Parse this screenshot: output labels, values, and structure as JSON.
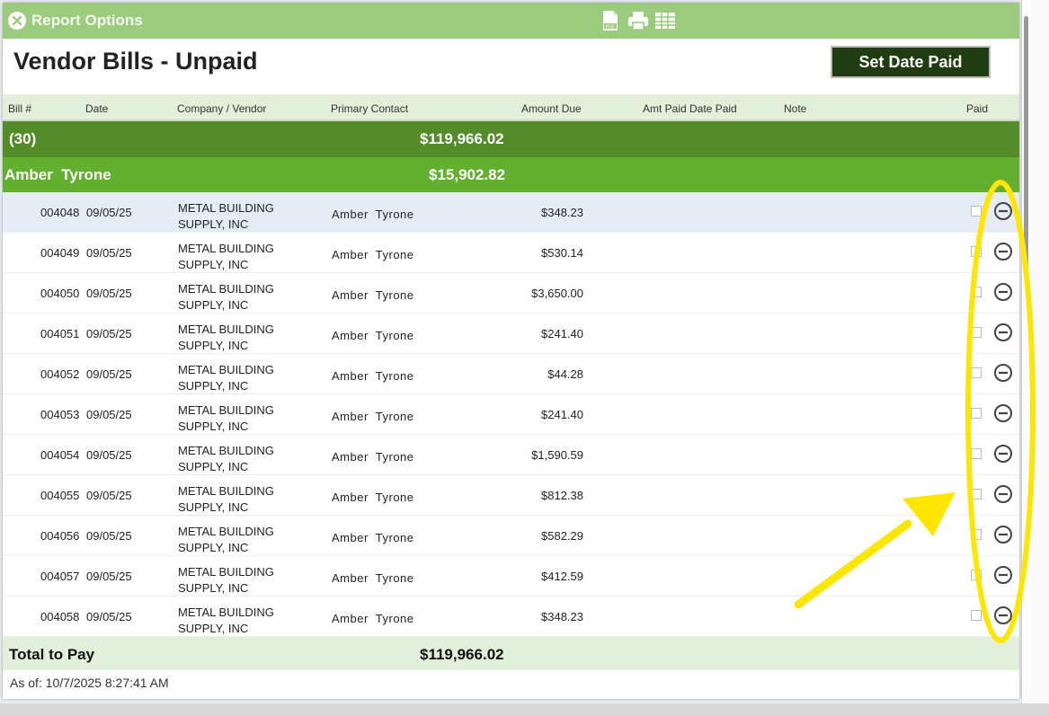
{
  "window": {
    "title": "Report Options",
    "tool_icons": [
      "pdf-icon",
      "print-icon",
      "spreadsheet-icon"
    ]
  },
  "report": {
    "title": "Vendor Bills - Unpaid",
    "set_date_paid_label": "Set Date Paid"
  },
  "columns": {
    "bill": "Bill #",
    "date": "Date",
    "company": "Company / Vendor",
    "contact": "Primary Contact",
    "amount": "Amount Due",
    "amt_paid_date": "Amt Paid Date Paid",
    "note": "Note",
    "paid": "Paid"
  },
  "group": {
    "label": "(30)",
    "total": "$119,966.02"
  },
  "subgroup": {
    "label": "Amber  Tyrone",
    "total": "$15,902.82"
  },
  "rows": [
    {
      "bill": "004048",
      "date": "09/05/25",
      "company_line1": "METAL BUILDING",
      "company_line2": "SUPPLY, INC",
      "contact": "Amber  Tyrone",
      "amount": "$348.23"
    },
    {
      "bill": "004049",
      "date": "09/05/25",
      "company_line1": "METAL BUILDING",
      "company_line2": "SUPPLY, INC",
      "contact": "Amber  Tyrone",
      "amount": "$530.14"
    },
    {
      "bill": "004050",
      "date": "09/05/25",
      "company_line1": "METAL BUILDING",
      "company_line2": "SUPPLY, INC",
      "contact": "Amber  Tyrone",
      "amount": "$3,650.00"
    },
    {
      "bill": "004051",
      "date": "09/05/25",
      "company_line1": "METAL BUILDING",
      "company_line2": "SUPPLY, INC",
      "contact": "Amber  Tyrone",
      "amount": "$241.40"
    },
    {
      "bill": "004052",
      "date": "09/05/25",
      "company_line1": "METAL BUILDING",
      "company_line2": "SUPPLY, INC",
      "contact": "Amber  Tyrone",
      "amount": "$44.28"
    },
    {
      "bill": "004053",
      "date": "09/05/25",
      "company_line1": "METAL BUILDING",
      "company_line2": "SUPPLY, INC",
      "contact": "Amber  Tyrone",
      "amount": "$241.40"
    },
    {
      "bill": "004054",
      "date": "09/05/25",
      "company_line1": "METAL BUILDING",
      "company_line2": "SUPPLY, INC",
      "contact": "Amber  Tyrone",
      "amount": "$1,590.59"
    },
    {
      "bill": "004055",
      "date": "09/05/25",
      "company_line1": "METAL BUILDING",
      "company_line2": "SUPPLY, INC",
      "contact": "Amber  Tyrone",
      "amount": "$812.38"
    },
    {
      "bill": "004056",
      "date": "09/05/25",
      "company_line1": "METAL BUILDING",
      "company_line2": "SUPPLY, INC",
      "contact": "Amber  Tyrone",
      "amount": "$582.29"
    },
    {
      "bill": "004057",
      "date": "09/05/25",
      "company_line1": "METAL BUILDING",
      "company_line2": "SUPPLY, INC",
      "contact": "Amber  Tyrone",
      "amount": "$412.59"
    },
    {
      "bill": "004058",
      "date": "09/05/25",
      "company_line1": "METAL BUILDING",
      "company_line2": "SUPPLY, INC",
      "contact": "Amber  Tyrone",
      "amount": "$348.23"
    }
  ],
  "footer": {
    "total_label": "Total to Pay",
    "total_value": "$119,966.02",
    "as_of": "As of: 10/7/2025 8:27:41 AM"
  },
  "colors": {
    "titlebar": "#9bcb7c",
    "group": "#548c2a",
    "subgroup": "#63af30",
    "button": "#203d12",
    "annotation": "#ffe600"
  }
}
